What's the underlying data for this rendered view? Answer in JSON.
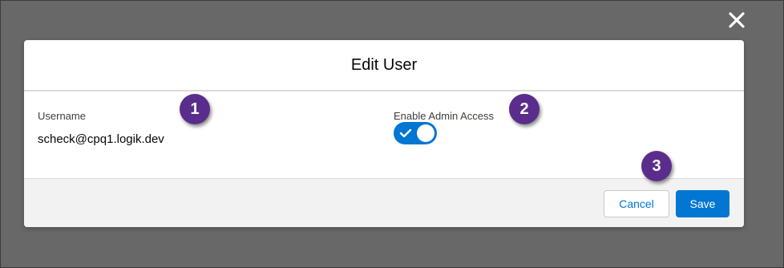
{
  "modal": {
    "title": "Edit User",
    "username": {
      "label": "Username",
      "value": "scheck@cpq1.logik.dev"
    },
    "admin_access": {
      "label": "Enable Admin Access",
      "enabled": true
    },
    "footer": {
      "cancel_label": "Cancel",
      "save_label": "Save"
    }
  },
  "callouts": [
    "1",
    "2",
    "3"
  ],
  "icons": {
    "close": "close-icon",
    "toggle_check": "checkmark-icon"
  },
  "colors": {
    "overlay": "#686868",
    "brand": "#0176d3",
    "callout": "#5a2d8c",
    "footer_bg": "#f3f2f2"
  }
}
